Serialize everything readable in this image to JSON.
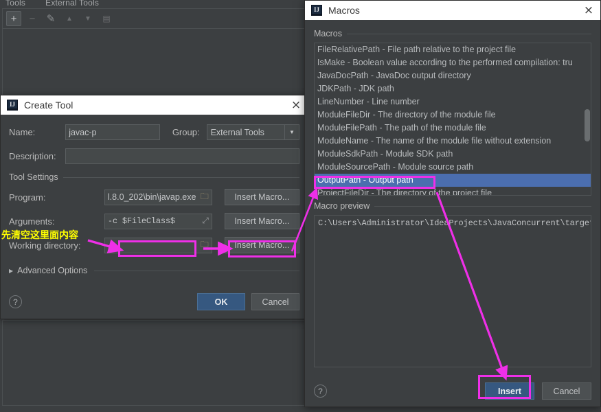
{
  "background": {
    "breadcrumb": [
      "Tools",
      "External Tools"
    ],
    "toolbar_icons": [
      "add-icon",
      "remove-icon",
      "edit-icon",
      "move-up-icon",
      "move-down-icon",
      "copy-icon"
    ]
  },
  "create_tool": {
    "title": "Create Tool",
    "app_icon": "IJ",
    "close_label": "×",
    "name_label": "Name:",
    "name_value": "javac-p",
    "group_label": "Group:",
    "group_value": "External Tools",
    "description_label": "Description:",
    "description_value": "",
    "tool_settings_label": "Tool Settings",
    "program_label": "Program:",
    "program_value": "l.8.0_202\\bin\\javap.exe",
    "program_browse_icon": "folder-icon",
    "program_insert_macro": "Insert Macro...",
    "arguments_label": "Arguments:",
    "arguments_value": "-c $FileClass$",
    "arguments_expand_icon": "expand-icon",
    "arguments_insert_macro": "Insert Macro...",
    "working_dir_label": "Working directory:",
    "working_dir_value": "",
    "working_dir_browse_icon": "folder-icon",
    "working_dir_insert_macro": "Insert Macro...",
    "advanced_options_label": "Advanced Options",
    "advanced_expand_icon": "triangle-right-icon",
    "help_label": "?",
    "ok_label": "OK",
    "cancel_label": "Cancel"
  },
  "macros_dialog": {
    "title": "Macros",
    "app_icon": "IJ",
    "close_label": "×",
    "macros_label": "Macros",
    "items": [
      "FileRelativePath - File path relative to the project file",
      "IsMake - Boolean value according to the performed compilation: tru",
      "JavaDocPath - JavaDoc output directory",
      "JDKPath - JDK path",
      "LineNumber - Line number",
      "ModuleFileDir - The directory of the module file",
      "ModuleFilePath - The path of the module file",
      "ModuleName - The name of the module file without extension",
      "ModuleSdkPath - Module SDK path",
      "ModuleSourcePath - Module source path",
      "OutputPath - Output path",
      "ProjectFileDir - The directory of the project file"
    ],
    "selected_index": 10,
    "preview_label": "Macro preview",
    "preview_value": "C:\\Users\\Administrator\\IdeaProjects\\JavaConcurrent\\target\\classes",
    "help_label": "?",
    "insert_label": "Insert",
    "cancel_label": "Cancel"
  },
  "annotations": {
    "note_clear_field": "先清空这里面内容",
    "highlight_color": "#ef2fe8",
    "note_color": "#ffff00"
  }
}
